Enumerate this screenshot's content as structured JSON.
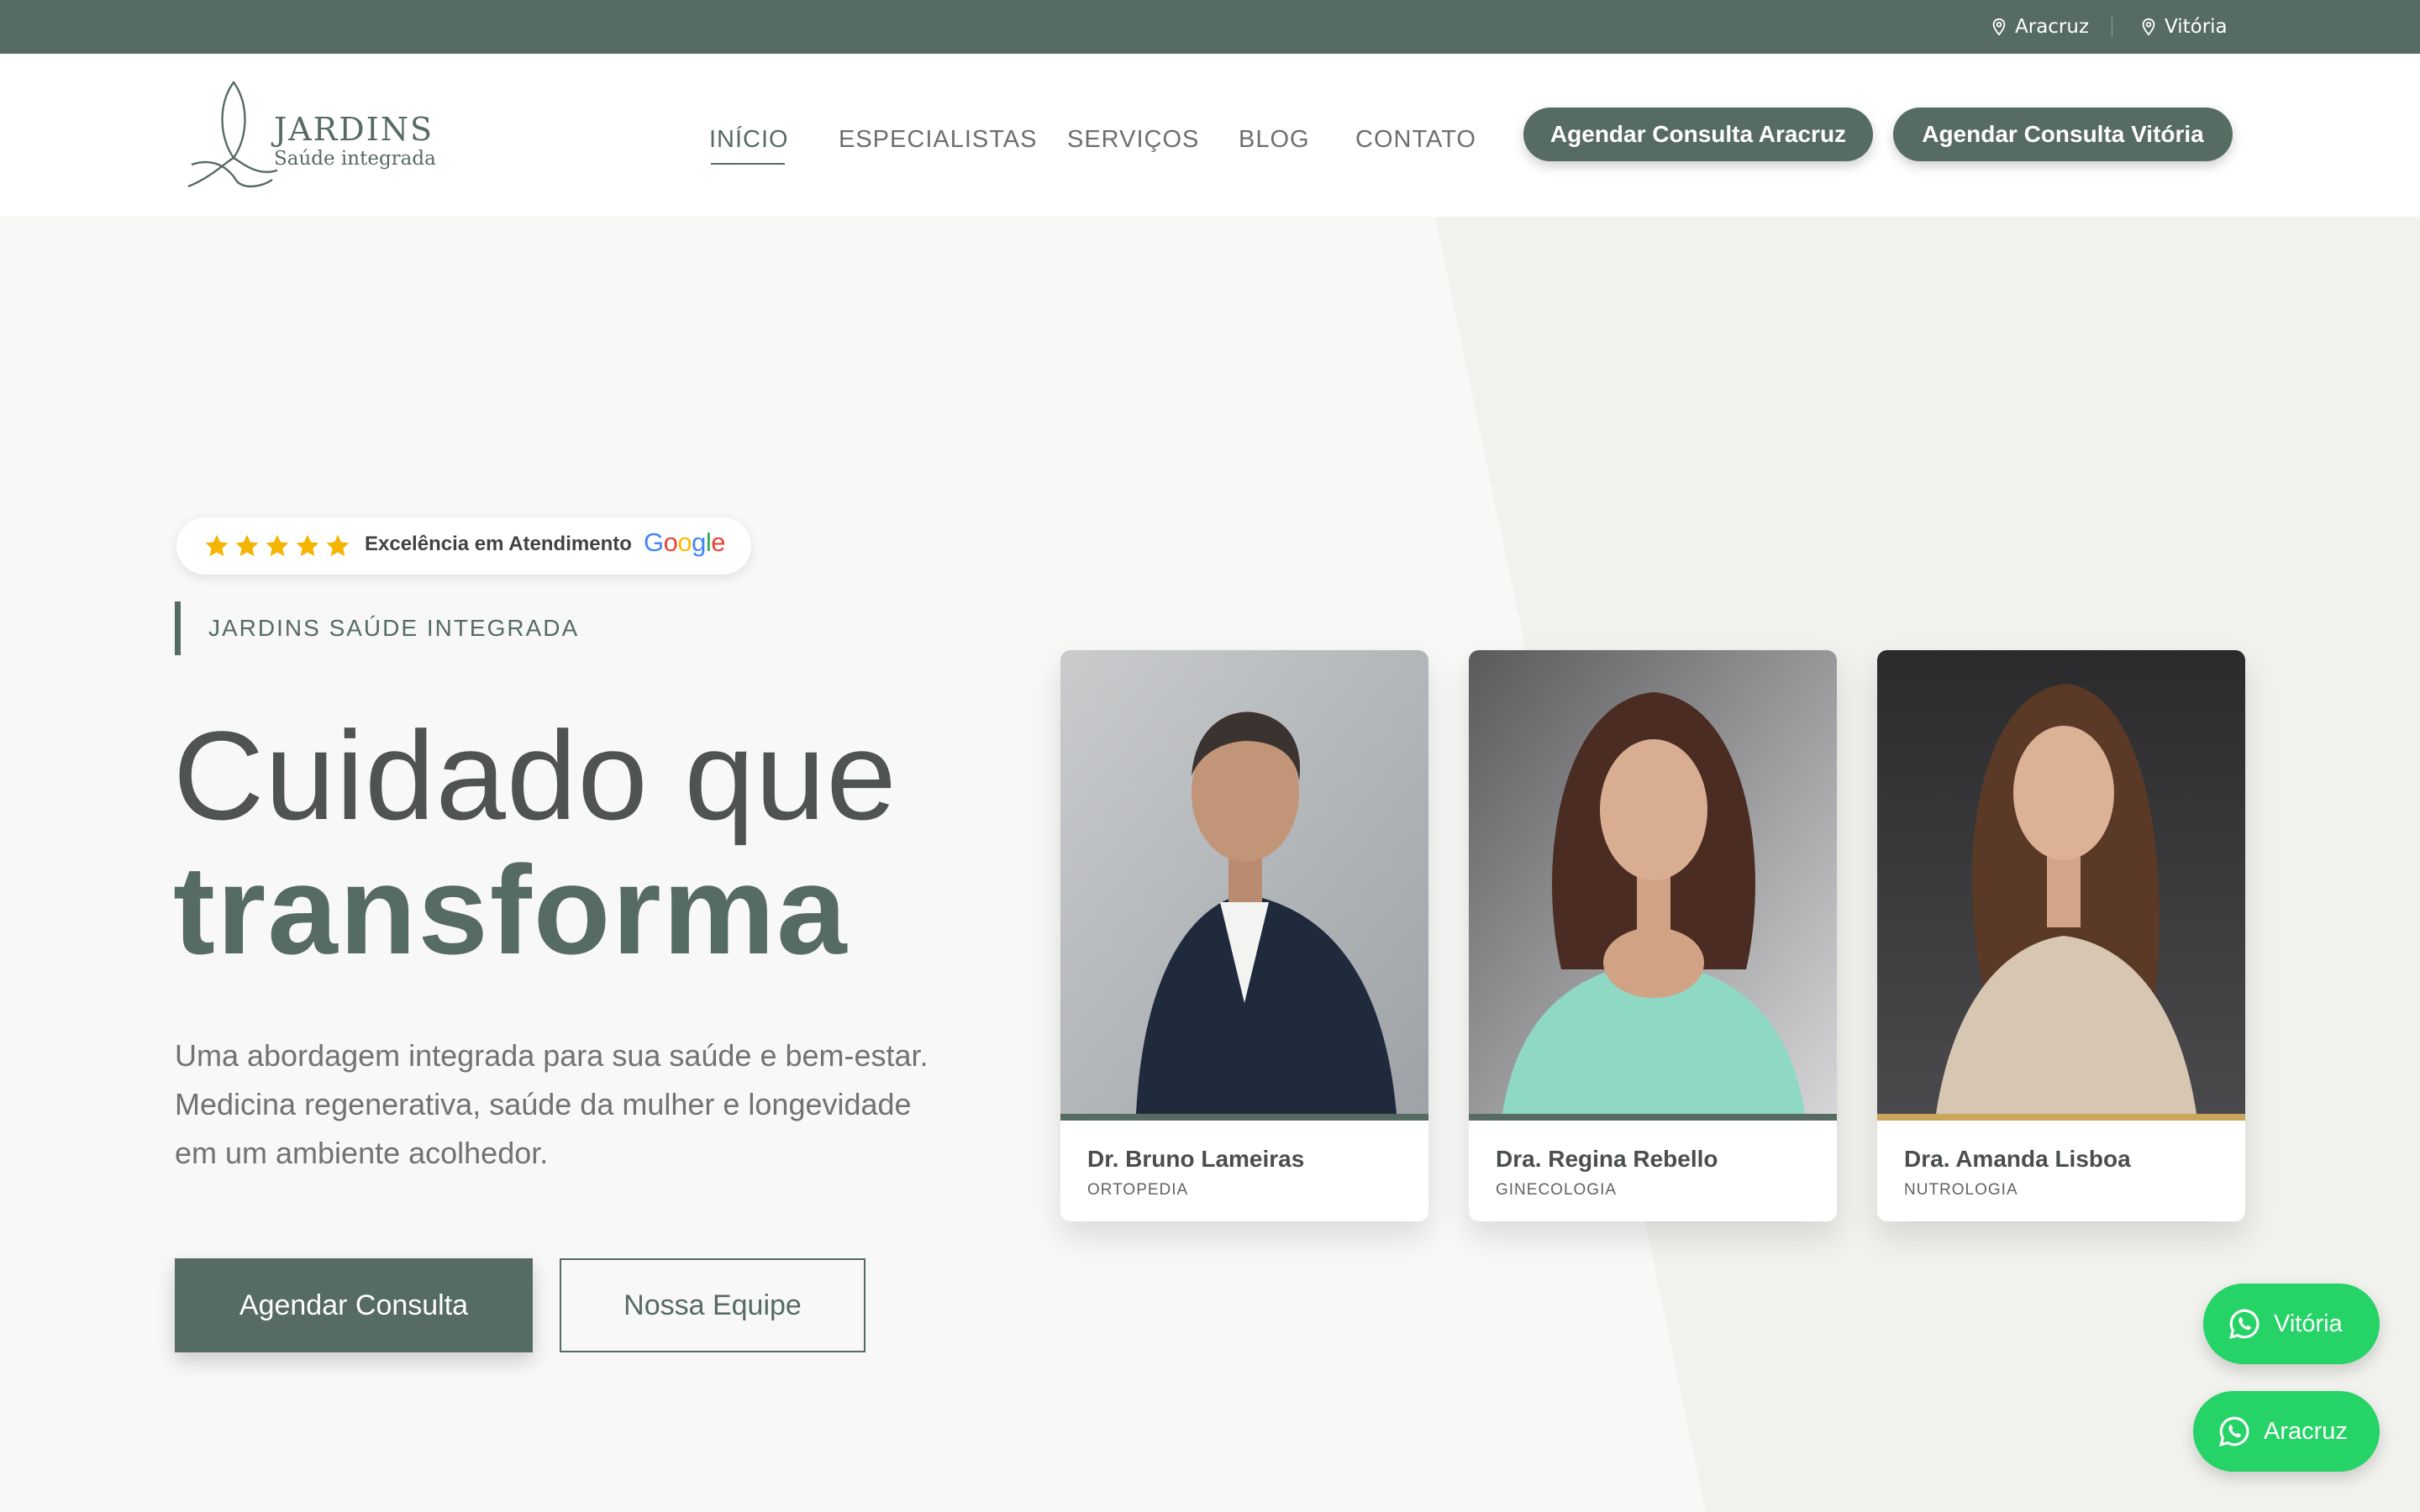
{
  "topbar": {
    "locations": [
      "Aracruz",
      "Vitória"
    ],
    "icon": "map-pin-icon"
  },
  "brand": {
    "name": "JARDINS",
    "tagline": "Saúde integrada",
    "color": "#566b62"
  },
  "nav": {
    "items": [
      "INÍCIO",
      "ESPECIALISTAS",
      "SERVIÇOS",
      "BLOG",
      "CONTATO"
    ],
    "active": "INÍCIO",
    "cta_aracruz": "Agendar Consulta Aracruz",
    "cta_vitoria": "Agendar Consulta Vitória"
  },
  "hero": {
    "badge_text": "Excelência em Atendimento",
    "badge_brand": "Google",
    "badge_stars": 5,
    "eyebrow": "JARDINS SAÚDE INTEGRADA",
    "title_light": "Cuidado que",
    "title_bold": "transforma",
    "lead_lines": [
      "Uma abordagem integrada para sua saúde e bem-estar.",
      "Medicina regenerativa, saúde da mulher e longevidade",
      "em um ambiente acolhedor."
    ],
    "btn_primary": "Agendar Consulta",
    "btn_secondary": "Nossa Equipe"
  },
  "doctors": [
    {
      "name": "Dr. Bruno Lameiras",
      "specialty": "ORTOPEDIA",
      "accent": "#566b62"
    },
    {
      "name": "Dra. Regina Rebello",
      "specialty": "GINECOLOGIA",
      "accent": "#566b62"
    },
    {
      "name": "Dra. Amanda Lisboa",
      "specialty": "NUTROLOGIA",
      "accent": "#c9a65a"
    }
  ],
  "whatsapp": {
    "vitoria": "Vitória",
    "aracruz": "Aracruz",
    "color": "#25d366",
    "icon": "whatsapp-icon"
  }
}
